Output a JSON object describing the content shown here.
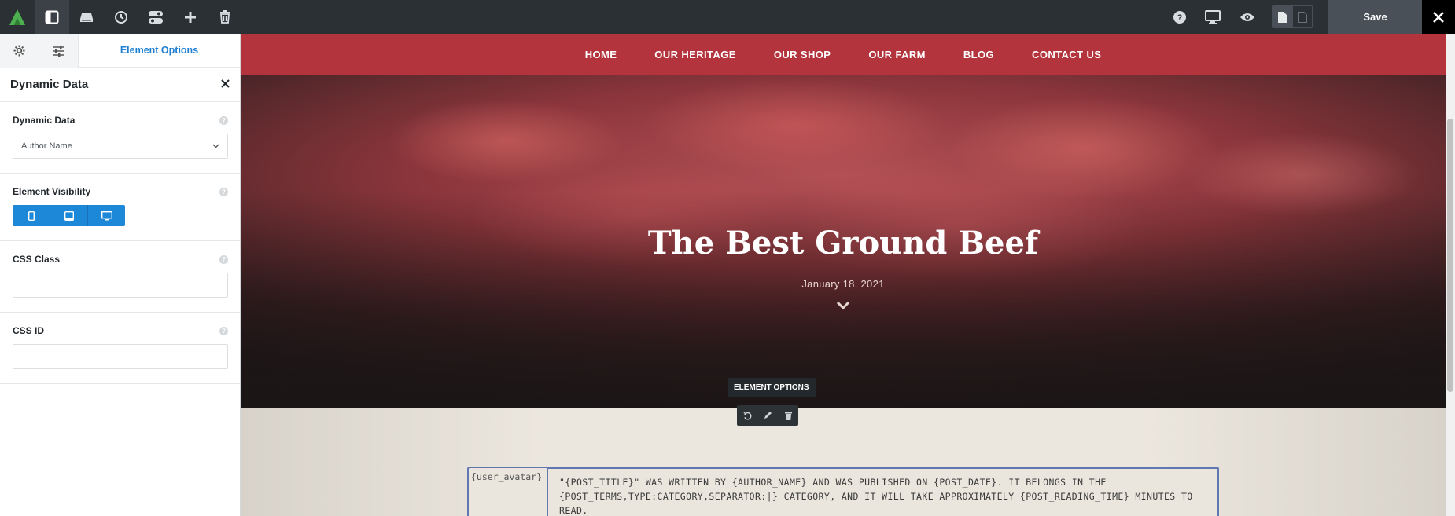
{
  "toolbar": {
    "save_label": "Save",
    "icons": [
      "logo-icon",
      "sidebar-panel-icon",
      "layers-icon",
      "history-icon",
      "toggles-icon",
      "add-icon",
      "trash-icon",
      "help-icon",
      "desktop-icon",
      "eye-icon",
      "page-icon",
      "page-outline-icon",
      "close-icon"
    ]
  },
  "panel": {
    "tab_label": "Element Options",
    "title": "Dynamic Data",
    "dynamic_data": {
      "label": "Dynamic Data",
      "value": "Author Name"
    },
    "visibility": {
      "label": "Element Visibility",
      "devices": [
        "mobile",
        "tablet",
        "desktop"
      ]
    },
    "css_class": {
      "label": "CSS Class",
      "value": ""
    },
    "css_id": {
      "label": "CSS ID",
      "value": ""
    },
    "help_glyph": "?"
  },
  "site": {
    "nav": [
      "HOME",
      "OUR HERITAGE",
      "OUR SHOP",
      "OUR FARM",
      "BLOG",
      "CONTACT US"
    ],
    "hero_title": "The Best Ground Beef",
    "hero_date": "January 18, 2021",
    "tooltip": "ELEMENT OPTIONS",
    "avatar_placeholder": "{user_avatar}",
    "author_text": "\"{POST_TITLE}\" WAS WRITTEN BY {AUTHOR_NAME} AND WAS PUBLISHED ON {POST_DATE}. IT BELONGS IN THE {POST_TERMS,TYPE:CATEGORY,SEPARATOR:|} CATEGORY, AND IT WILL TAKE APPROXIMATELY {POST_READING_TIME} MINUTES TO READ."
  },
  "colors": {
    "toolbar_bg": "#2b3035",
    "accent_blue": "#1e88d8",
    "nav_red": "#b3343c",
    "selection_border": "#6077b0"
  }
}
